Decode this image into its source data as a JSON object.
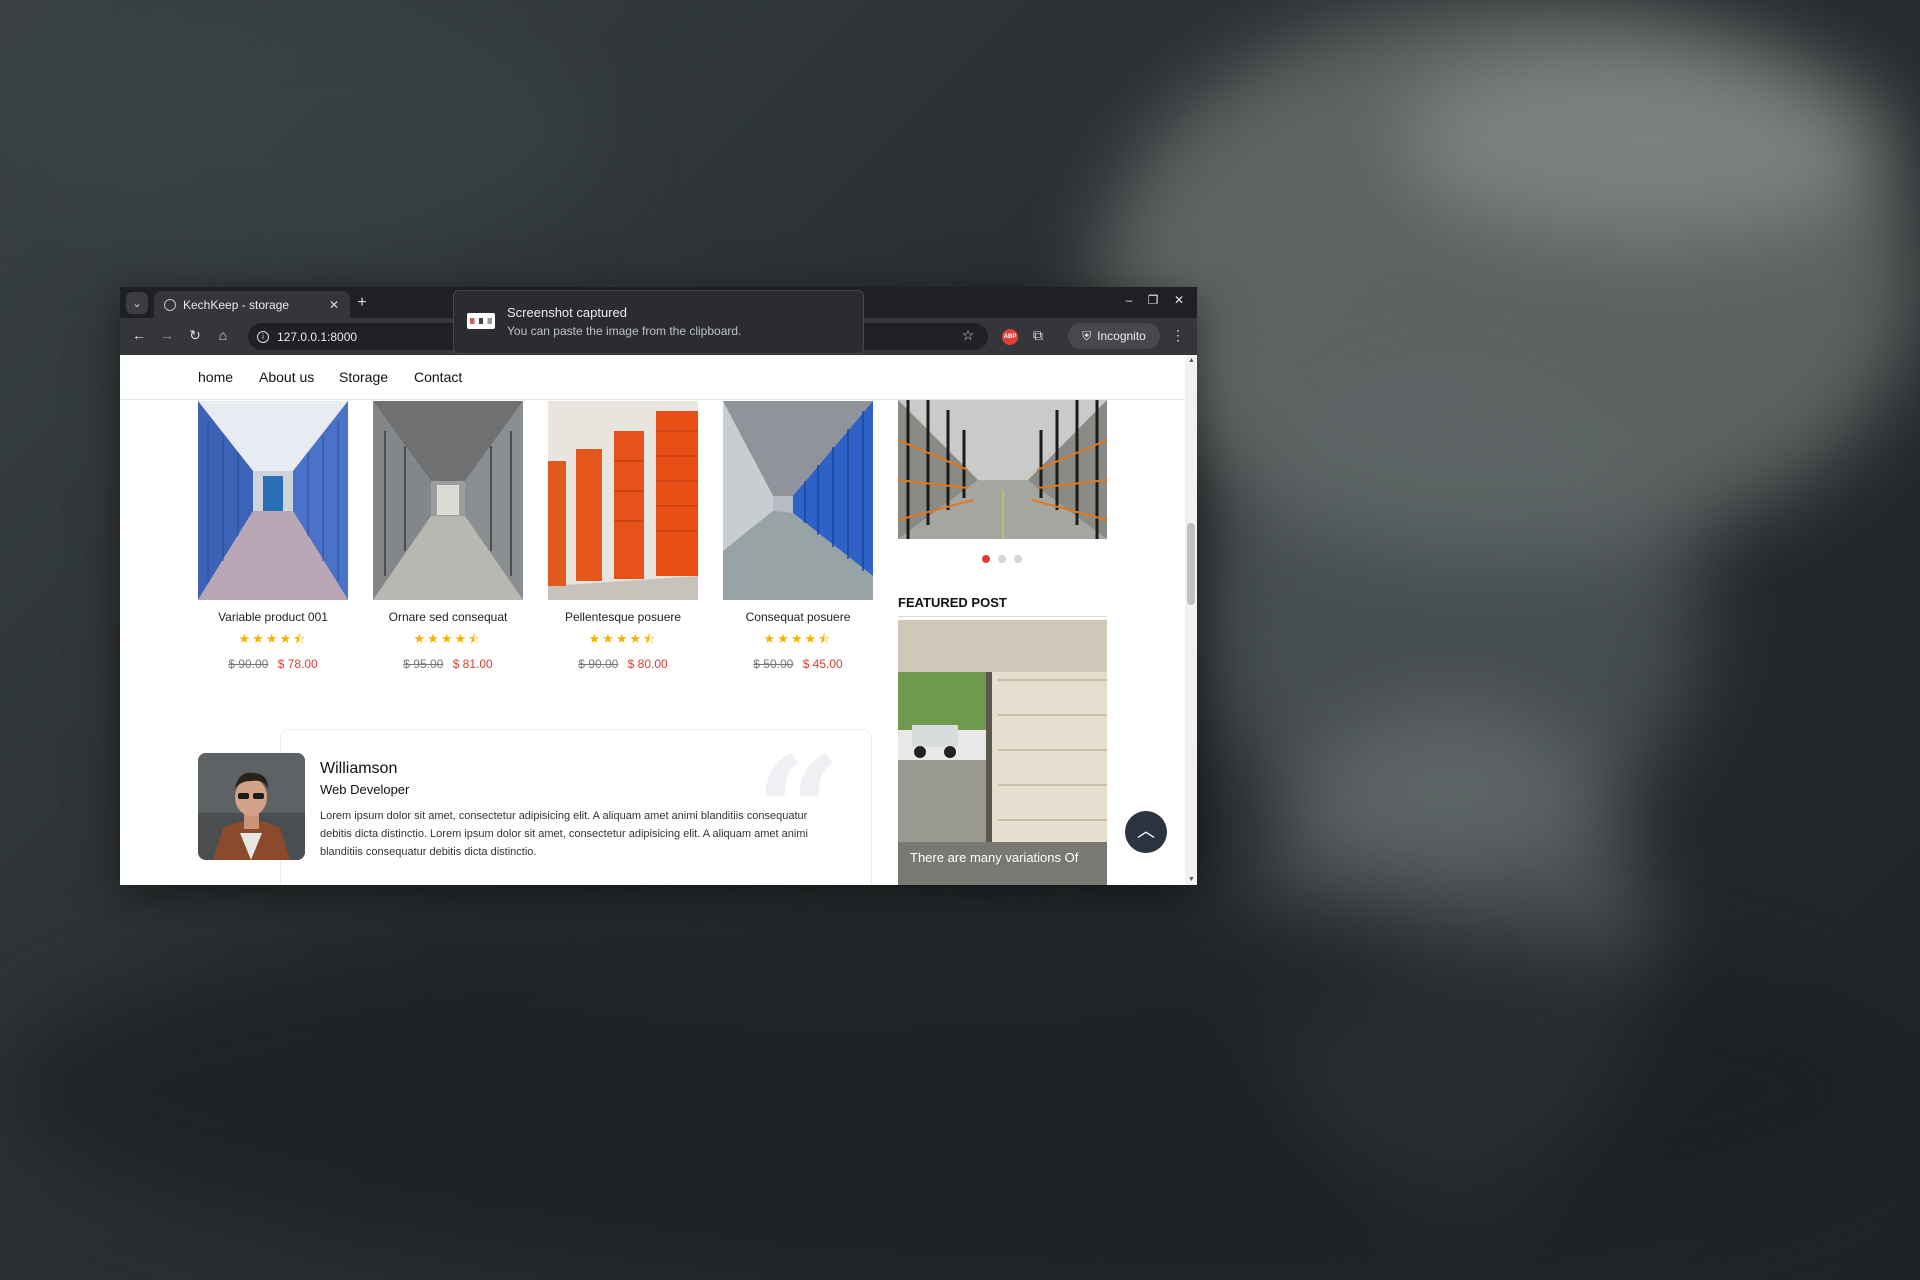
{
  "browser": {
    "tab_title": "KechKeep - storage",
    "url": "127.0.0.1:8000",
    "incognito_label": "Incognito",
    "abp_label": "ABP"
  },
  "toast": {
    "title": "Screenshot captured",
    "message": "You can paste the image from the clipboard."
  },
  "nav": {
    "items": [
      "home",
      "About us",
      "Storage",
      "Contact"
    ]
  },
  "products": [
    {
      "name": "Variable product 001",
      "old_price": "$ 90.00",
      "price": "$ 78.00",
      "rating": 4.5
    },
    {
      "name": "Ornare sed consequat",
      "old_price": "$ 95.00",
      "price": "$ 81.00",
      "rating": 4.5
    },
    {
      "name": "Pellentesque posuere",
      "old_price": "$ 90.00",
      "price": "$ 80.00",
      "rating": 4.5
    },
    {
      "name": "Consequat posuere",
      "old_price": "$ 50.00",
      "price": "$ 45.00",
      "rating": 4.5
    }
  ],
  "stars_text": "★★★★⯪",
  "slider": {
    "active_index": 0,
    "count": 3
  },
  "featured": {
    "title": "FEATURED POST",
    "caption": "There are many variations Of"
  },
  "testimonial": {
    "name": "Williamson",
    "role": "Web Developer",
    "body": "Lorem ipsum dolor sit amet, consectetur adipisicing elit. A aliquam amet animi blanditiis consequatur debitis dicta distinctio. Lorem ipsum dolor sit amet, consectetur adipisicing elit. A aliquam amet animi blanditiis consequatur debitis dicta distinctio.",
    "quote_glyph": "“"
  },
  "colors": {
    "accent": "#e53935",
    "price_red": "#e03a2e",
    "star": "#f5b301",
    "back_to_top": "#2b3440"
  },
  "icons": {
    "back": "←",
    "forward": "→",
    "reload": "↻",
    "home": "⌂",
    "star": "☆",
    "extensions": "⧉",
    "menu": "⋮",
    "tab_menu": "⌄",
    "close": "✕",
    "new_tab": "+",
    "minimize": "–",
    "maximize": "❐",
    "win_close": "✕",
    "up": "︿",
    "scroll_up": "▲",
    "scroll_down": "▼",
    "info": "i",
    "incognito": "⛨"
  }
}
